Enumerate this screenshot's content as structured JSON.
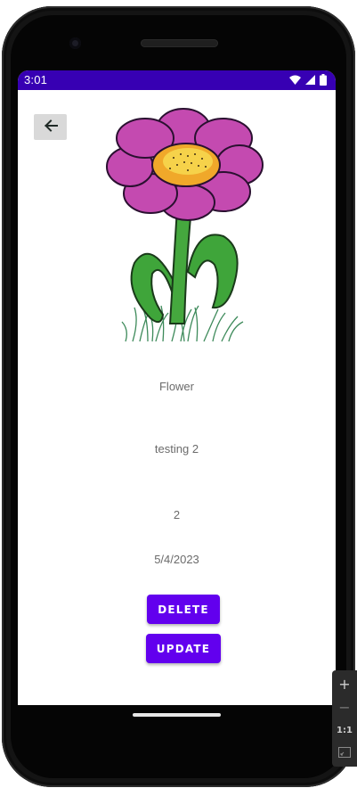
{
  "status_bar": {
    "time": "3:01",
    "color": "#3700b3",
    "icons": [
      "wifi-icon",
      "cell-signal-icon",
      "battery-icon"
    ]
  },
  "toolbar": {
    "back_icon": "arrow-left-icon"
  },
  "image": {
    "subject": "flower"
  },
  "detail": {
    "title": "Flower",
    "description": "testing 2",
    "quantity": "2",
    "date": "5/4/2023"
  },
  "actions": {
    "delete_label": "DELETE",
    "update_label": "UPDATE",
    "color": "#6200ee"
  },
  "zoom_controls": {
    "zoom_in": "+",
    "zoom_out": "−",
    "actual_size": "1:1"
  }
}
